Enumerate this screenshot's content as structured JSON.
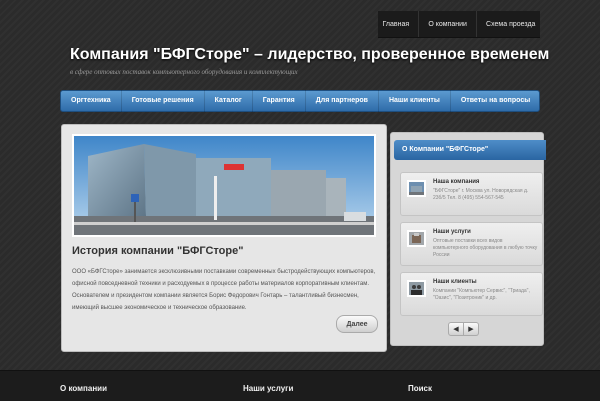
{
  "topnav": {
    "items": [
      "Главная",
      "О компании",
      "Схема проезда"
    ]
  },
  "header": {
    "title": "Компания \"БФГСторе\" – лидерство, проверенное временем",
    "tagline": "в сфере оптовых поставок компьютерного оборудования и комплектующих"
  },
  "mainnav": {
    "items": [
      "Оргтехника",
      "Готовые решения",
      "Каталог",
      "Гарантия",
      "Для партнеров",
      "Наши клиенты",
      "Ответы на вопросы"
    ]
  },
  "featured": {
    "title": "История компании \"БФГСторе\"",
    "text": "ООО «БФГСторе» занимается эксклюзивными поставками современных быстродействующих компьютеров, офисной повседневной техники и расходуемых в процессе работы материалов корпоративным клиентам. Основателем и президентом компании является Борис Федорович Гонтарь – талантливый бизнесмен, имеющий высшее экономическое и техническое образование.",
    "more_label": "Далее"
  },
  "aside": {
    "heading": "О Компании \"БФГСторе\"",
    "cards": [
      {
        "title": "Наша компания",
        "text": "\"БФГСторе\" г. Москва ул. Новорядская д. 23б/5 Тел. 8 (495) 554-567-545"
      },
      {
        "title": "Наши услуги",
        "text": "Оптовые поставки всех видов компьютерного оборудования в любую точку России"
      },
      {
        "title": "Наши клиенты",
        "text": "Компании \"Компьютер Сервис\", \"Триада\", \"Оазис\", \"Позитроник\" и др."
      }
    ],
    "prev_icon": "arrow-left-icon",
    "next_icon": "arrow-right-icon"
  },
  "footer": {
    "headings": [
      "О компании",
      "Наши услуги",
      "Поиск"
    ]
  },
  "colors": {
    "accent": "#3574b2",
    "background": "#2b2b2b"
  }
}
